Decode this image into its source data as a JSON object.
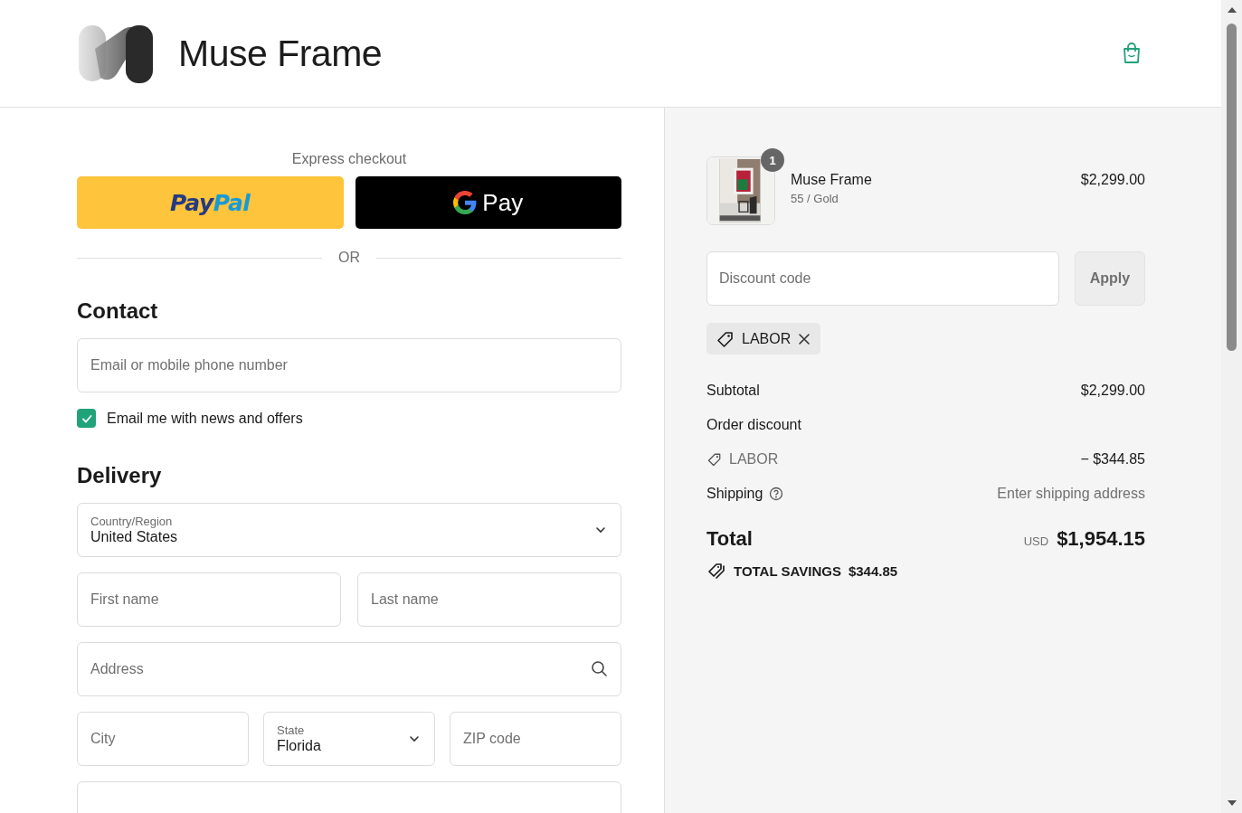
{
  "header": {
    "brand": "Muse Frame"
  },
  "express": {
    "title": "Express checkout",
    "buttons": [
      {
        "kind": "paypal",
        "label": [
          "Pay",
          "Pal"
        ]
      },
      {
        "kind": "gpay",
        "label": [
          "Pay"
        ]
      }
    ],
    "divider": "OR"
  },
  "contact": {
    "heading": "Contact",
    "email": {
      "placeholder": "Email or mobile phone number"
    },
    "newsletter": {
      "label": "Email me with news and offers",
      "checked": true
    }
  },
  "delivery": {
    "heading": "Delivery",
    "rows": [
      [
        {
          "kind": "select",
          "label": "Country/Region",
          "value": "United States"
        }
      ],
      [
        {
          "kind": "text",
          "placeholder": "First name"
        },
        {
          "kind": "text",
          "placeholder": "Last name"
        }
      ],
      [
        {
          "kind": "search",
          "placeholder": "Address"
        }
      ],
      [
        {
          "kind": "text",
          "placeholder": "City"
        },
        {
          "kind": "select",
          "label": "State",
          "value": "Florida"
        },
        {
          "kind": "text",
          "placeholder": "ZIP code"
        }
      ],
      [
        {
          "kind": "text"
        }
      ]
    ]
  },
  "summary": {
    "item": {
      "quantity": "1",
      "name": "Muse Frame",
      "variant": "55 / Gold",
      "price": "$2,299.00"
    },
    "discount": {
      "placeholder": "Discount code",
      "button": "Apply"
    },
    "applied_codes": [
      {
        "code": "LABOR"
      }
    ],
    "lines": [
      {
        "kind": "plain",
        "label": "Subtotal",
        "value": "$2,299.00"
      },
      {
        "kind": "heading",
        "label": "Order discount"
      },
      {
        "kind": "code",
        "label": "LABOR",
        "value": "− $344.85"
      },
      {
        "kind": "help",
        "label": "Shipping",
        "value": "Enter shipping address"
      }
    ],
    "total": {
      "label": "Total",
      "currency": "USD",
      "amount": "$1,954.15"
    },
    "savings": {
      "label": "TOTAL SAVINGS",
      "amount": "$344.85"
    }
  }
}
